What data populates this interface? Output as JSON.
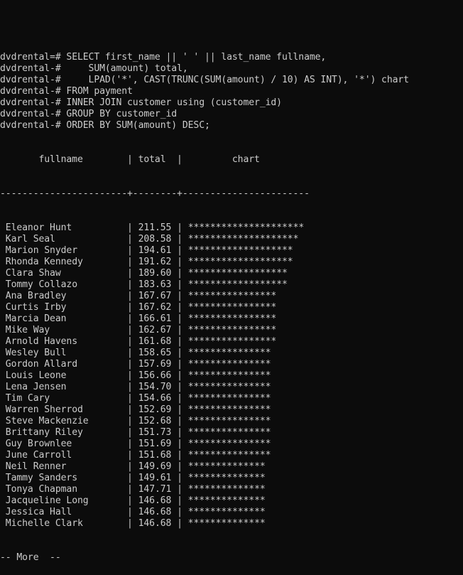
{
  "terminal": {
    "prompt_primary": "dvdrental=# ",
    "prompt_continuation": "dvdrental-# ",
    "query_lines": [
      {
        "prompt": "dvdrental=# ",
        "text": "SELECT first_name || ' ' || last_name fullname,"
      },
      {
        "prompt": "dvdrental-# ",
        "text": "    SUM(amount) total,"
      },
      {
        "prompt": "dvdrental-# ",
        "text": "    LPAD('*', CAST(TRUNC(SUM(amount) / 10) AS INT), '*') chart"
      },
      {
        "prompt": "dvdrental-# ",
        "text": "FROM payment"
      },
      {
        "prompt": "dvdrental-# ",
        "text": "INNER JOIN customer using (customer_id)"
      },
      {
        "prompt": "dvdrental-# ",
        "text": "GROUP BY customer_id"
      },
      {
        "prompt": "dvdrental-# ",
        "text": "ORDER BY SUM(amount) DESC;"
      }
    ],
    "result": {
      "columns": [
        "fullname",
        "total",
        "chart"
      ],
      "header_line": "       fullname        | total  |         chart",
      "separator_line": "-----------------------+--------+-----------------------",
      "rows": [
        {
          "fullname": "Eleanor Hunt",
          "total": "211.55",
          "chart": "*********************"
        },
        {
          "fullname": "Karl Seal",
          "total": "208.58",
          "chart": "********************"
        },
        {
          "fullname": "Marion Snyder",
          "total": "194.61",
          "chart": "*******************"
        },
        {
          "fullname": "Rhonda Kennedy",
          "total": "191.62",
          "chart": "*******************"
        },
        {
          "fullname": "Clara Shaw",
          "total": "189.60",
          "chart": "******************"
        },
        {
          "fullname": "Tommy Collazo",
          "total": "183.63",
          "chart": "******************"
        },
        {
          "fullname": "Ana Bradley",
          "total": "167.67",
          "chart": "****************"
        },
        {
          "fullname": "Curtis Irby",
          "total": "167.62",
          "chart": "****************"
        },
        {
          "fullname": "Marcia Dean",
          "total": "166.61",
          "chart": "****************"
        },
        {
          "fullname": "Mike Way",
          "total": "162.67",
          "chart": "****************"
        },
        {
          "fullname": "Arnold Havens",
          "total": "161.68",
          "chart": "****************"
        },
        {
          "fullname": "Wesley Bull",
          "total": "158.65",
          "chart": "***************"
        },
        {
          "fullname": "Gordon Allard",
          "total": "157.69",
          "chart": "***************"
        },
        {
          "fullname": "Louis Leone",
          "total": "156.66",
          "chart": "***************"
        },
        {
          "fullname": "Lena Jensen",
          "total": "154.70",
          "chart": "***************"
        },
        {
          "fullname": "Tim Cary",
          "total": "154.66",
          "chart": "***************"
        },
        {
          "fullname": "Warren Sherrod",
          "total": "152.69",
          "chart": "***************"
        },
        {
          "fullname": "Steve Mackenzie",
          "total": "152.68",
          "chart": "***************"
        },
        {
          "fullname": "Brittany Riley",
          "total": "151.73",
          "chart": "***************"
        },
        {
          "fullname": "Guy Brownlee",
          "total": "151.69",
          "chart": "***************"
        },
        {
          "fullname": "June Carroll",
          "total": "151.68",
          "chart": "***************"
        },
        {
          "fullname": "Neil Renner",
          "total": "149.69",
          "chart": "**************"
        },
        {
          "fullname": "Tammy Sanders",
          "total": "149.61",
          "chart": "**************"
        },
        {
          "fullname": "Tonya Chapman",
          "total": "147.71",
          "chart": "**************"
        },
        {
          "fullname": "Jacqueline Long",
          "total": "146.68",
          "chart": "**************"
        },
        {
          "fullname": "Jessica Hall",
          "total": "146.68",
          "chart": "**************"
        },
        {
          "fullname": "Michelle Clark",
          "total": "146.68",
          "chart": "**************"
        }
      ]
    },
    "pager_prompt": "-- More  --"
  },
  "colors": {
    "background": "#0c0c0c",
    "foreground": "#cccccc"
  }
}
